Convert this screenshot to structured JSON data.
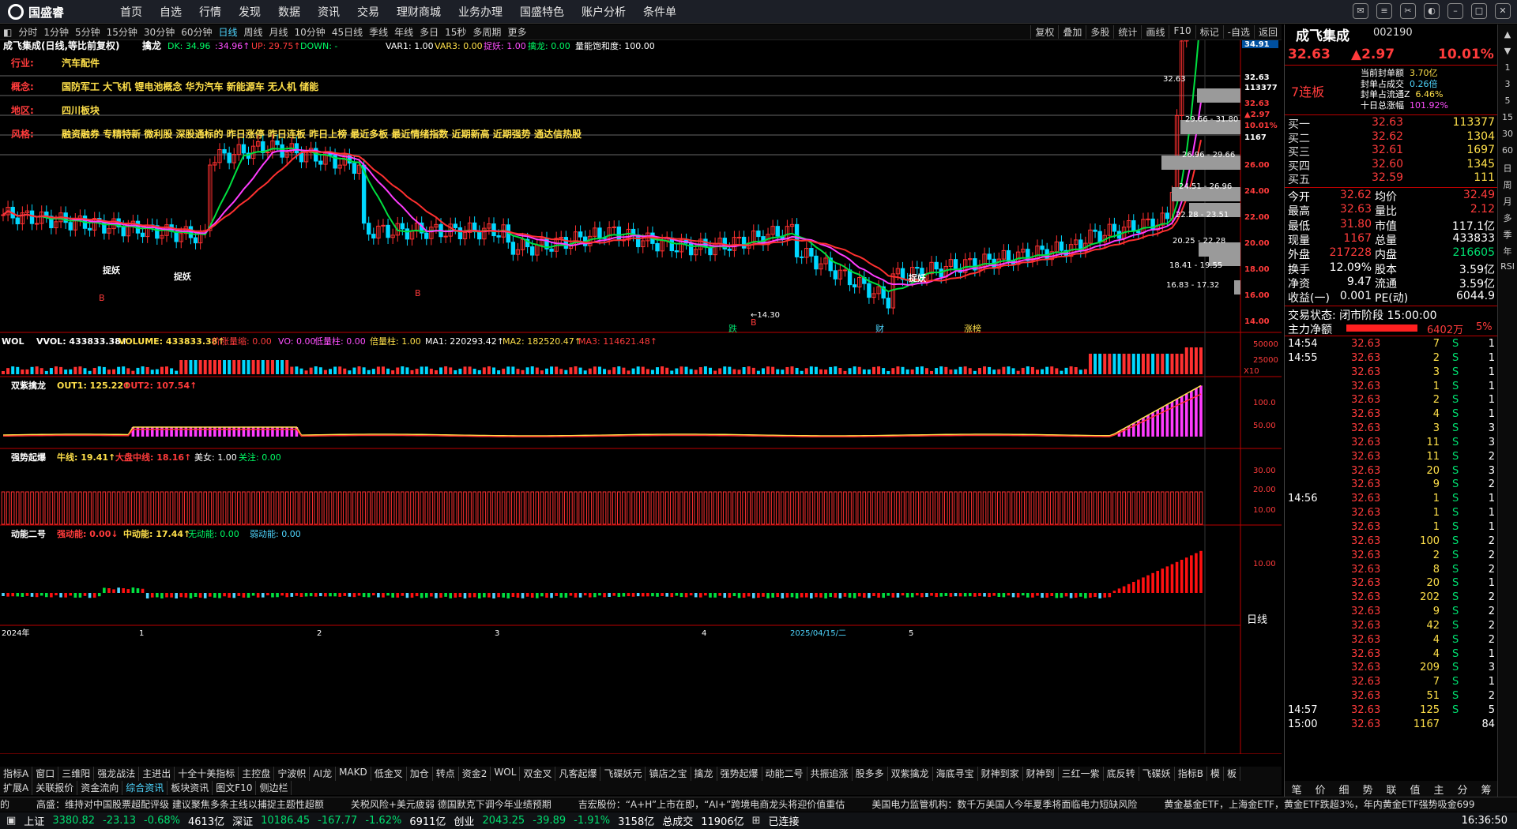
{
  "app": {
    "logo": "国盛睿",
    "nav": [
      "首页",
      "自选",
      "行情",
      "发现",
      "数据",
      "资讯",
      "交易",
      "理财商城",
      "业务办理",
      "国盛特色",
      "账户分析",
      "条件单"
    ]
  },
  "periods": [
    "分时",
    "1分钟",
    "5分钟",
    "15分钟",
    "30分钟",
    "60分钟",
    "日线",
    "周线",
    "月线",
    "10分钟",
    "45日线",
    "季线",
    "年线",
    "多日",
    "15秒",
    "多周期",
    "更多"
  ],
  "active_period": "日线",
  "tools": [
    "复权",
    "叠加",
    "多股",
    "统计",
    "画线",
    "F10",
    "标记",
    "-自选",
    "返回"
  ],
  "chart_header": {
    "name": "成飞集成(日线,等比前复权)",
    "ind": "擒龙",
    "dk": "DK: 34.96",
    "b1": ":34.96↑",
    "up": "UP: 29.75↑",
    "down": "DOWN: -",
    "var1": "VAR1: 1.00",
    "var3": "VAR3: 0.00",
    "zy": "捉妖: 1.00",
    "ql": "擒龙: 0.00",
    "lnbh": "量能饱和度: 100.00"
  },
  "info": {
    "industry_label": "行业:",
    "industry": "汽车配件",
    "concept_label": "概念:",
    "concept": "国防军工 大飞机 锂电池概念 华为汽车 新能源车 无人机 储能",
    "region_label": "地区:",
    "region": "四川板块",
    "style_label": "风格:",
    "style": "融资融券 专精特新 微利股 深股通标的 昨日涨停 昨日连板 昨日上榜 最近多板 最近情绪指数 近期新高 近期强势 通达信热股"
  },
  "price_axis": [
    "34.91",
    "32.63",
    "113377",
    "32.63",
    "▲2.97",
    "10.01%",
    "1167",
    "26.00",
    "24.00",
    "22.00",
    "20.00",
    "18.00",
    "16.00",
    "14.00"
  ],
  "chip_labels": [
    "32.63",
    "29.66 - 31.80",
    "26.96 - 29.66",
    "24.51 - 26.96",
    "22.28 - 23.51",
    "20.25 - 22.28",
    "18.41 - 19.55",
    "16.83 - 17.32"
  ],
  "marks": {
    "zy": "捉妖",
    "low": "←14.30",
    "b": "B",
    "die": "跌",
    "cai": "财",
    "zhangbang": "涨榜"
  },
  "vol_header": {
    "t": "WOL",
    "vvol": "VVOL: 433833.38↑",
    "volume": "VOLUME: 433833.38↑",
    "jzl": "价涨量缩: 0.00",
    "vo": "VO: 0.00",
    "dlz": "低量柱: 0.00",
    "blz": "倍量柱: 1.00",
    "ma1": "MA1: 220293.42↑",
    "ma2": "MA2: 182520.47↑",
    "ma3": "MA3: 114621.48↑"
  },
  "vol_axis": [
    "50000",
    "25000",
    "X10"
  ],
  "sz_header": {
    "t": "双紫擒龙",
    "o1": "OUT1: 125.22↑",
    "o2": "OUT2: 107.54↑"
  },
  "sz_axis": [
    "100.0",
    "50.00"
  ],
  "qs_header": {
    "t": "强势起爆",
    "nx": "牛线: 19.41↑",
    "dp": "大盘中线: 18.16↑",
    "mn": "美女: 1.00",
    "gz": "关注: 0.00"
  },
  "qs_axis": [
    "30.00",
    "20.00",
    "10.00"
  ],
  "dn_header": {
    "t": "动能二号",
    "q": "强动能: 0.00↓",
    "z": "中动能: 17.44↑",
    "w": "无动能: 0.00",
    "r": "弱动能: 0.00"
  },
  "dn_axis": [
    "10.00"
  ],
  "x_axis": [
    "2024年",
    "1",
    "2",
    "3",
    "4",
    "2025/04/15/二",
    "5"
  ],
  "day_line": "日线",
  "bottom_tabs": [
    "指标A",
    "窗口",
    "三维阳",
    "强龙战法",
    "主进出",
    "十全十美指标",
    "主控盘",
    "宁波帜",
    "AI龙",
    "MAKD",
    "低金叉",
    "加仓",
    "转点",
    "资金2",
    "WOL",
    "双金叉",
    "凡客起爆",
    "飞碟妖元",
    "镇店之宝",
    "擒龙",
    "强势起爆",
    "动能二号",
    "共振追涨",
    "股多多",
    "双紫擒龙",
    "海底寻宝",
    "财神到家",
    "财神到",
    "三红一紫",
    "底反转",
    "飞碟妖",
    "指标B",
    "模",
    "板"
  ],
  "bottom_tabs2": [
    "扩展A",
    "关联报价",
    "资金流向",
    "综合资讯",
    "板块资讯",
    "图文F10",
    "侧边栏"
  ],
  "ticker": [
    "的",
    "高盛：维持对中国股票超配评级 建议聚焦多条主线以捕捉主题性超额",
    "关税风险+美元疲弱 德国默克下调今年业绩预期",
    "吉宏股份：“A+H”上市在即，“AI+”跨境电商龙头将迎价值重估",
    "美国电力监管机构：数千万美国人今年夏季将面临电力短缺风险",
    "黄金基金ETF，上海金ETF，黄金ETF跌超3%，年内黄金ETF强势吸金699"
  ],
  "status": {
    "sh": "上证",
    "sh_v": "3380.82",
    "sh_c": "-23.13",
    "sh_p": "-0.68%",
    "sh_a": "4613亿",
    "sz": "深证",
    "sz_v": "10186.45",
    "sz_c": "-167.77",
    "sz_p": "-1.62%",
    "sz_a": "6911亿",
    "cy": "创业",
    "cy_v": "2043.25",
    "cy_c": "-39.89",
    "cy_p": "-1.91%",
    "cy_a": "3158亿",
    "total": "总成交",
    "total_v": "11906亿",
    "conn": "已连接",
    "time": "16:36:50"
  },
  "quote": {
    "name": "成飞集成",
    "code": "002190",
    "price": "32.63",
    "chg": "▲2.97",
    "pct": "10.01%",
    "board": "7连板",
    "seal_l": "当前封单额",
    "seal_v": "3.70亿",
    "fc_l": "封单占成交",
    "fc_v": "0.26倍",
    "fl_l": "封单占流通Z",
    "fl_v": "6.46%",
    "sr_l": "十日总涨幅",
    "sr_v": "101.92%"
  },
  "order_book": [
    [
      "买一",
      "32.63",
      "113377"
    ],
    [
      "买二",
      "32.62",
      "1304"
    ],
    [
      "买三",
      "32.61",
      "1697"
    ],
    [
      "买四",
      "32.60",
      "1345"
    ],
    [
      "买五",
      "32.59",
      "111"
    ]
  ],
  "stats": [
    [
      "今开",
      "32.62",
      "均价",
      "32.49"
    ],
    [
      "最高",
      "32.63",
      "量比",
      "2.12"
    ],
    [
      "最低",
      "31.80",
      "市值",
      "117.1亿"
    ],
    [
      "现量",
      "1167",
      "总量",
      "433833"
    ],
    [
      "外盘",
      "217228",
      "内盘",
      "216605"
    ],
    [
      "换手",
      "12.09%",
      "股本",
      "3.59亿"
    ],
    [
      "净资",
      "9.47",
      "流通",
      "3.59亿"
    ],
    [
      "收益(一)",
      "0.001",
      "PE(动)",
      "6044.9"
    ]
  ],
  "trade_state": "交易状态: 闭市阶段 15:00:00",
  "net_main": {
    "label": "主力净额",
    "val": "6402万",
    "pct": "5%"
  },
  "ticks": [
    [
      "14:54",
      "32.63",
      "7",
      "S",
      "1"
    ],
    [
      "14:55",
      "32.63",
      "2",
      "S",
      "1"
    ],
    [
      "",
      "32.63",
      "3",
      "S",
      "1"
    ],
    [
      "",
      "32.63",
      "1",
      "S",
      "1"
    ],
    [
      "",
      "32.63",
      "2",
      "S",
      "1"
    ],
    [
      "",
      "32.63",
      "4",
      "S",
      "1"
    ],
    [
      "",
      "32.63",
      "3",
      "S",
      "3"
    ],
    [
      "",
      "32.63",
      "11",
      "S",
      "3"
    ],
    [
      "",
      "32.63",
      "11",
      "S",
      "2"
    ],
    [
      "",
      "32.63",
      "20",
      "S",
      "3"
    ],
    [
      "",
      "32.63",
      "9",
      "S",
      "2"
    ],
    [
      "14:56",
      "32.63",
      "1",
      "S",
      "1"
    ],
    [
      "",
      "32.63",
      "1",
      "S",
      "1"
    ],
    [
      "",
      "32.63",
      "1",
      "S",
      "1"
    ],
    [
      "",
      "32.63",
      "100",
      "S",
      "2"
    ],
    [
      "",
      "32.63",
      "2",
      "S",
      "2"
    ],
    [
      "",
      "32.63",
      "8",
      "S",
      "2"
    ],
    [
      "",
      "32.63",
      "20",
      "S",
      "1"
    ],
    [
      "",
      "32.63",
      "202",
      "S",
      "2"
    ],
    [
      "",
      "32.63",
      "9",
      "S",
      "2"
    ],
    [
      "",
      "32.63",
      "42",
      "S",
      "2"
    ],
    [
      "",
      "32.63",
      "4",
      "S",
      "2"
    ],
    [
      "",
      "32.63",
      "4",
      "S",
      "1"
    ],
    [
      "",
      "32.63",
      "209",
      "S",
      "3"
    ],
    [
      "",
      "32.63",
      "7",
      "S",
      "1"
    ],
    [
      "",
      "32.63",
      "51",
      "S",
      "2"
    ],
    [
      "14:57",
      "32.63",
      "125",
      "S",
      "5"
    ],
    [
      "15:00",
      "32.63",
      "1167",
      "",
      "84"
    ]
  ],
  "right_tabs": [
    "笔",
    "价",
    "细",
    "势",
    "联",
    "值",
    "主",
    "分",
    "筹"
  ],
  "side_icons": [
    "▲",
    "▼",
    "1",
    "3",
    "5",
    "15",
    "30",
    "60",
    "日",
    "周",
    "月",
    "多",
    "季",
    "年",
    "RSI"
  ]
}
